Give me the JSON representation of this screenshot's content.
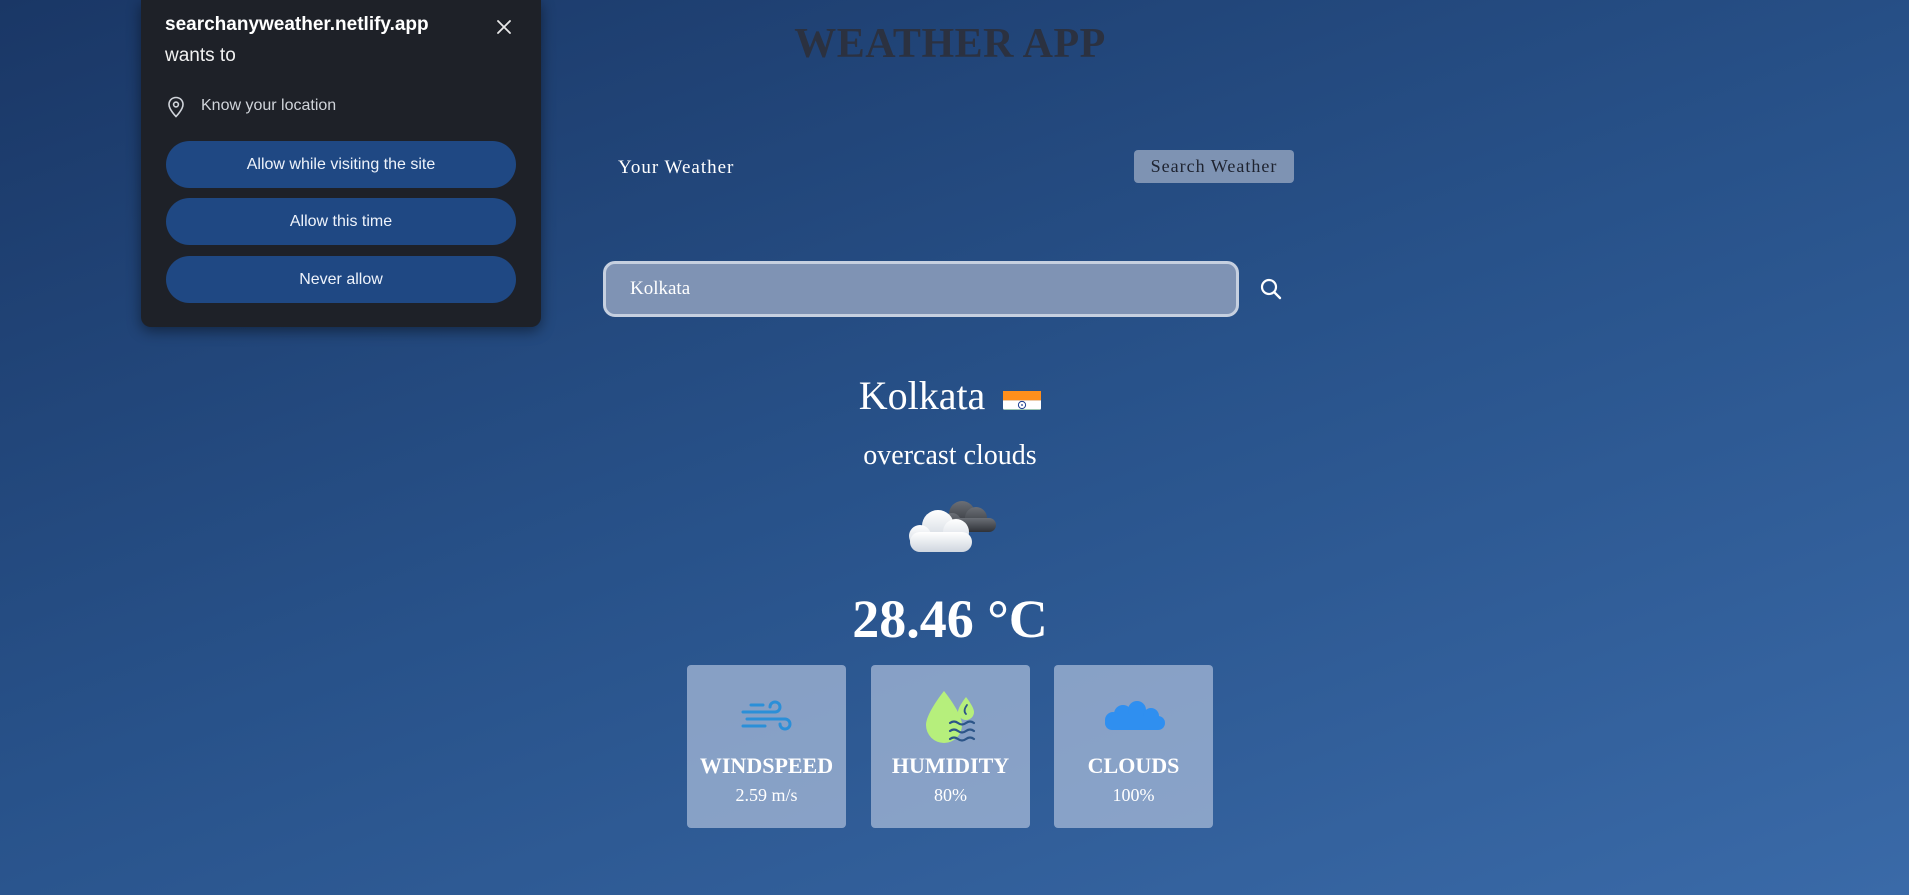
{
  "app": {
    "title": "WEATHER APP"
  },
  "tabs": {
    "your_weather": "Your Weather",
    "search_weather": "Search Weather"
  },
  "search": {
    "value": "Kolkata"
  },
  "weather": {
    "city": "Kolkata",
    "country_flag": "india-flag-icon",
    "description": "overcast clouds",
    "condition_icon": "cloud-icon",
    "temperature": "28.46 °C"
  },
  "cards": [
    {
      "icon": "wind-icon",
      "label": "WINDSPEED",
      "value": "2.59 m/s"
    },
    {
      "icon": "humidity-icon",
      "label": "HUMIDITY",
      "value": "80%"
    },
    {
      "icon": "clouds-icon",
      "label": "CLOUDS",
      "value": "100%"
    }
  ],
  "permission_popup": {
    "site": "searchanyweather.netlify.app",
    "wants_to": "wants to",
    "permission": "Know your location",
    "buttons": [
      "Allow while visiting the site",
      "Allow this time",
      "Never allow"
    ]
  },
  "colors": {
    "background_top": "#1a3766",
    "background_bottom": "#3a6aa8",
    "card_bg": "#aabcda",
    "popup_bg": "#1e2128",
    "popup_button": "#1f4883",
    "wind_icon": "#2b8fd8",
    "humidity_icon": "#b6ef7c",
    "clouds_icon": "#2f8ff0"
  }
}
